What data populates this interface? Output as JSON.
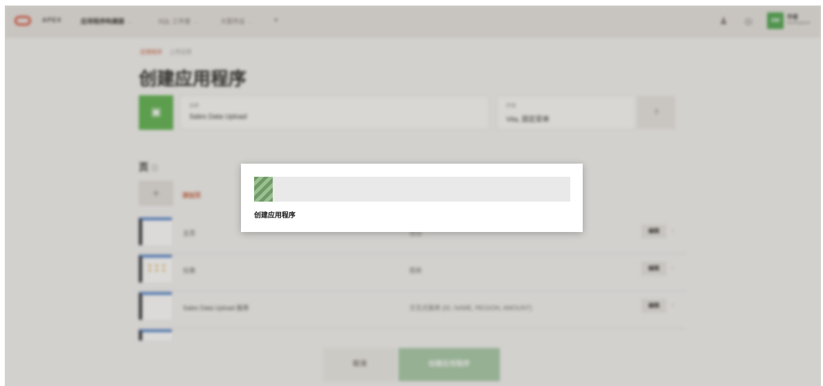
{
  "header": {
    "brand": "APEX",
    "nav": [
      {
        "label": "应用程序构建器",
        "strong": true
      },
      {
        "label": "SQL 工作室",
        "strong": false
      },
      {
        "label": "大型作业",
        "strong": false
      }
    ],
    "user_initials": "AW",
    "user_name": "作者",
    "user_workspace": "workspace"
  },
  "breadcrumb": [
    "应用程序",
    "上传应用"
  ],
  "page_title": "创建应用程序",
  "form": {
    "name_label": "名称",
    "name_value": "Sales Data Upload",
    "theme_label": "外观",
    "theme_value": "Vita, 固定菜单",
    "help_icon": "help-icon"
  },
  "pages_section": {
    "title": "页",
    "add_label": "添加页",
    "rows": [
      {
        "name": "主页",
        "desc": "空白",
        "button": "编辑"
      },
      {
        "name": "仪表",
        "desc": "图表",
        "button": "编辑"
      },
      {
        "name": "Sales Data Upload 报表",
        "desc": "交互式报表 (ID, NAME, REGION, AMOUNT)",
        "button": "编辑"
      }
    ]
  },
  "footer": {
    "cancel_label": "取消",
    "create_label": "创建应用程序"
  },
  "dialog": {
    "label": "创建应用程序",
    "progress": 0.06
  },
  "colors": {
    "accent": "#c2532f",
    "brand_green": "#59b04a",
    "progress": "#6f9a66"
  }
}
